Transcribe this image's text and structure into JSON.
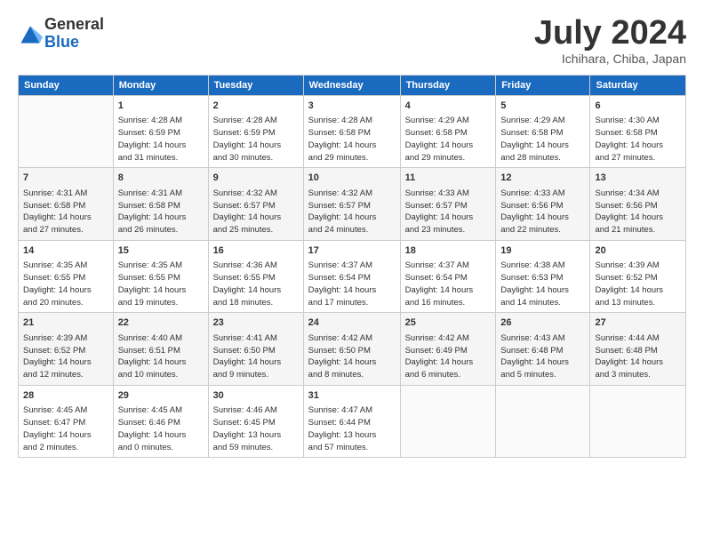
{
  "header": {
    "logo_line1": "General",
    "logo_line2": "Blue",
    "month_title": "July 2024",
    "location": "Ichihara, Chiba, Japan"
  },
  "weekdays": [
    "Sunday",
    "Monday",
    "Tuesday",
    "Wednesday",
    "Thursday",
    "Friday",
    "Saturday"
  ],
  "weeks": [
    [
      {
        "day": "",
        "info": ""
      },
      {
        "day": "1",
        "info": "Sunrise: 4:28 AM\nSunset: 6:59 PM\nDaylight: 14 hours\nand 31 minutes."
      },
      {
        "day": "2",
        "info": "Sunrise: 4:28 AM\nSunset: 6:59 PM\nDaylight: 14 hours\nand 30 minutes."
      },
      {
        "day": "3",
        "info": "Sunrise: 4:28 AM\nSunset: 6:58 PM\nDaylight: 14 hours\nand 29 minutes."
      },
      {
        "day": "4",
        "info": "Sunrise: 4:29 AM\nSunset: 6:58 PM\nDaylight: 14 hours\nand 29 minutes."
      },
      {
        "day": "5",
        "info": "Sunrise: 4:29 AM\nSunset: 6:58 PM\nDaylight: 14 hours\nand 28 minutes."
      },
      {
        "day": "6",
        "info": "Sunrise: 4:30 AM\nSunset: 6:58 PM\nDaylight: 14 hours\nand 27 minutes."
      }
    ],
    [
      {
        "day": "7",
        "info": "Sunrise: 4:31 AM\nSunset: 6:58 PM\nDaylight: 14 hours\nand 27 minutes."
      },
      {
        "day": "8",
        "info": "Sunrise: 4:31 AM\nSunset: 6:58 PM\nDaylight: 14 hours\nand 26 minutes."
      },
      {
        "day": "9",
        "info": "Sunrise: 4:32 AM\nSunset: 6:57 PM\nDaylight: 14 hours\nand 25 minutes."
      },
      {
        "day": "10",
        "info": "Sunrise: 4:32 AM\nSunset: 6:57 PM\nDaylight: 14 hours\nand 24 minutes."
      },
      {
        "day": "11",
        "info": "Sunrise: 4:33 AM\nSunset: 6:57 PM\nDaylight: 14 hours\nand 23 minutes."
      },
      {
        "day": "12",
        "info": "Sunrise: 4:33 AM\nSunset: 6:56 PM\nDaylight: 14 hours\nand 22 minutes."
      },
      {
        "day": "13",
        "info": "Sunrise: 4:34 AM\nSunset: 6:56 PM\nDaylight: 14 hours\nand 21 minutes."
      }
    ],
    [
      {
        "day": "14",
        "info": "Sunrise: 4:35 AM\nSunset: 6:55 PM\nDaylight: 14 hours\nand 20 minutes."
      },
      {
        "day": "15",
        "info": "Sunrise: 4:35 AM\nSunset: 6:55 PM\nDaylight: 14 hours\nand 19 minutes."
      },
      {
        "day": "16",
        "info": "Sunrise: 4:36 AM\nSunset: 6:55 PM\nDaylight: 14 hours\nand 18 minutes."
      },
      {
        "day": "17",
        "info": "Sunrise: 4:37 AM\nSunset: 6:54 PM\nDaylight: 14 hours\nand 17 minutes."
      },
      {
        "day": "18",
        "info": "Sunrise: 4:37 AM\nSunset: 6:54 PM\nDaylight: 14 hours\nand 16 minutes."
      },
      {
        "day": "19",
        "info": "Sunrise: 4:38 AM\nSunset: 6:53 PM\nDaylight: 14 hours\nand 14 minutes."
      },
      {
        "day": "20",
        "info": "Sunrise: 4:39 AM\nSunset: 6:52 PM\nDaylight: 14 hours\nand 13 minutes."
      }
    ],
    [
      {
        "day": "21",
        "info": "Sunrise: 4:39 AM\nSunset: 6:52 PM\nDaylight: 14 hours\nand 12 minutes."
      },
      {
        "day": "22",
        "info": "Sunrise: 4:40 AM\nSunset: 6:51 PM\nDaylight: 14 hours\nand 10 minutes."
      },
      {
        "day": "23",
        "info": "Sunrise: 4:41 AM\nSunset: 6:50 PM\nDaylight: 14 hours\nand 9 minutes."
      },
      {
        "day": "24",
        "info": "Sunrise: 4:42 AM\nSunset: 6:50 PM\nDaylight: 14 hours\nand 8 minutes."
      },
      {
        "day": "25",
        "info": "Sunrise: 4:42 AM\nSunset: 6:49 PM\nDaylight: 14 hours\nand 6 minutes."
      },
      {
        "day": "26",
        "info": "Sunrise: 4:43 AM\nSunset: 6:48 PM\nDaylight: 14 hours\nand 5 minutes."
      },
      {
        "day": "27",
        "info": "Sunrise: 4:44 AM\nSunset: 6:48 PM\nDaylight: 14 hours\nand 3 minutes."
      }
    ],
    [
      {
        "day": "28",
        "info": "Sunrise: 4:45 AM\nSunset: 6:47 PM\nDaylight: 14 hours\nand 2 minutes."
      },
      {
        "day": "29",
        "info": "Sunrise: 4:45 AM\nSunset: 6:46 PM\nDaylight: 14 hours\nand 0 minutes."
      },
      {
        "day": "30",
        "info": "Sunrise: 4:46 AM\nSunset: 6:45 PM\nDaylight: 13 hours\nand 59 minutes."
      },
      {
        "day": "31",
        "info": "Sunrise: 4:47 AM\nSunset: 6:44 PM\nDaylight: 13 hours\nand 57 minutes."
      },
      {
        "day": "",
        "info": ""
      },
      {
        "day": "",
        "info": ""
      },
      {
        "day": "",
        "info": ""
      }
    ]
  ]
}
